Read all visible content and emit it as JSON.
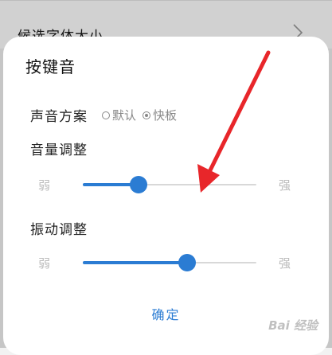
{
  "background": {
    "row_label": "候选字体大小"
  },
  "dialog": {
    "title": "按键音",
    "sound_scheme": {
      "label": "声音方案",
      "options": [
        {
          "label": "默认",
          "selected": false
        },
        {
          "label": "快板",
          "selected": true
        }
      ]
    },
    "volume": {
      "label": "音量调整",
      "min_label": "弱",
      "max_label": "强",
      "value": 0.32
    },
    "vibration": {
      "label": "振动调整",
      "min_label": "弱",
      "max_label": "强",
      "value": 0.6
    },
    "confirm_label": "确定"
  },
  "watermark": "Bai 经验",
  "colors": {
    "accent": "#2b7cd3",
    "annotation_arrow": "#e8262a"
  }
}
